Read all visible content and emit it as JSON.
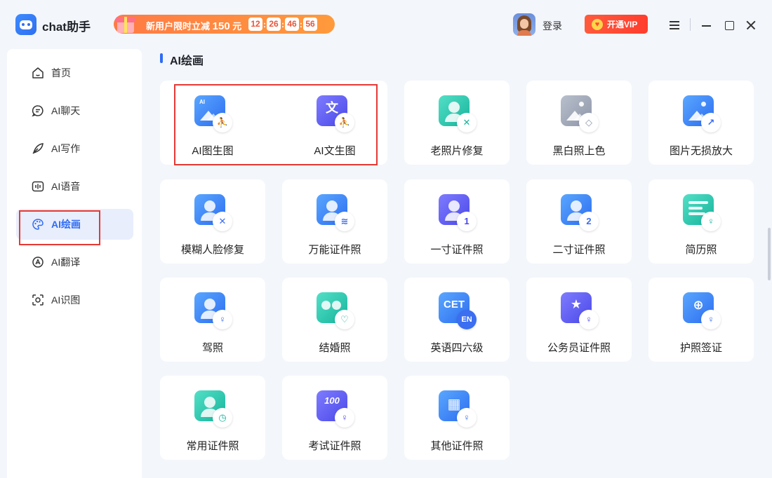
{
  "app": {
    "name": "chat助手"
  },
  "promo": {
    "text": "新用户限时立减",
    "amount": "150",
    "unit": "元",
    "timer": [
      "12",
      "26",
      "46",
      "56"
    ]
  },
  "header": {
    "login_label": "登录",
    "vip_label": "开通VIP"
  },
  "sidebar": {
    "items": [
      {
        "label": "首页",
        "icon": "home-icon"
      },
      {
        "label": "AI聊天",
        "icon": "chat-icon"
      },
      {
        "label": "AI写作",
        "icon": "feather-icon"
      },
      {
        "label": "AI语音",
        "icon": "audio-wave-icon"
      },
      {
        "label": "AI绘画",
        "icon": "palette-icon",
        "active": true
      },
      {
        "label": "AI翻译",
        "icon": "translate-icon"
      },
      {
        "label": "AI识图",
        "icon": "image-recognize-icon"
      }
    ]
  },
  "main": {
    "section_title": "AI绘画",
    "tools": [
      {
        "label": "AI图生图",
        "icon": "image-to-image-icon",
        "color": "blue"
      },
      {
        "label": "AI文生图",
        "icon": "text-to-image-icon",
        "color": "purple"
      },
      {
        "label": "老照片修复",
        "icon": "old-photo-restore-icon",
        "color": "teal"
      },
      {
        "label": "黑白照上色",
        "icon": "colorize-icon",
        "color": "grey"
      },
      {
        "label": "图片无损放大",
        "icon": "image-upscale-icon",
        "color": "blue"
      },
      {
        "label": "模糊人脸修复",
        "icon": "face-restore-icon",
        "color": "blue"
      },
      {
        "label": "万能证件照",
        "icon": "universal-id-photo-icon",
        "color": "blue"
      },
      {
        "label": "一寸证件照",
        "icon": "one-inch-photo-icon",
        "color": "purple"
      },
      {
        "label": "二寸证件照",
        "icon": "two-inch-photo-icon",
        "color": "blue"
      },
      {
        "label": "简历照",
        "icon": "resume-photo-icon",
        "color": "teal"
      },
      {
        "label": "驾照",
        "icon": "driver-license-icon",
        "color": "blue"
      },
      {
        "label": "结婚照",
        "icon": "marriage-photo-icon",
        "color": "teal"
      },
      {
        "label": "英语四六级",
        "icon": "cet-icon",
        "color": "blue",
        "glyph": "CET",
        "badge": "EN"
      },
      {
        "label": "公务员证件照",
        "icon": "civil-servant-icon",
        "color": "purple"
      },
      {
        "label": "护照签证",
        "icon": "passport-visa-icon",
        "color": "blue"
      },
      {
        "label": "常用证件照",
        "icon": "common-id-photo-icon",
        "color": "teal"
      },
      {
        "label": "考试证件照",
        "icon": "exam-photo-icon",
        "color": "purple",
        "glyph": "100"
      },
      {
        "label": "其他证件照",
        "icon": "other-id-photo-icon",
        "color": "blue"
      }
    ]
  },
  "badges": {
    "one": "1",
    "two": "2",
    "text_glyph": "文",
    "ai_glyph": "AI"
  }
}
